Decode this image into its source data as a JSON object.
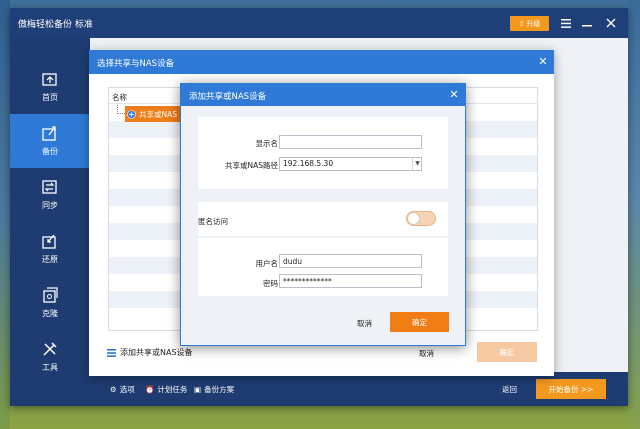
{
  "app": {
    "title": "傲梅轻松备份 标准",
    "upgrade_label": "升级"
  },
  "sidebar": {
    "items": [
      {
        "label": "首页",
        "icon": "home-icon"
      },
      {
        "label": "备份",
        "icon": "backup-icon",
        "active": true
      },
      {
        "label": "同步",
        "icon": "sync-icon"
      },
      {
        "label": "还原",
        "icon": "restore-icon"
      },
      {
        "label": "克隆",
        "icon": "clone-icon"
      },
      {
        "label": "工具",
        "icon": "tools-icon"
      }
    ]
  },
  "bottombar": {
    "options_label": "选项",
    "schedule_label": "计划任务",
    "scheme_label": "备份方案",
    "back_label": "返回",
    "start_label": "开始备份 >>"
  },
  "select_dialog": {
    "title": "选择共享与NAS设备",
    "column_header": "名称",
    "tree_node": "共享或NAS",
    "add_link": "添加共享或NAS设备",
    "cancel_label": "取消",
    "ok_label": "确定"
  },
  "add_dialog": {
    "title": "添加共享或NAS设备",
    "display_name_label": "显示名",
    "display_name_value": "",
    "path_label": "共享或NAS路径",
    "path_value": "192.168.5.30",
    "anonymous_label": "匿名访问",
    "anonymous_enabled": false,
    "username_label": "用户名",
    "username_value": "dudu",
    "password_label": "密码",
    "password_value": "*************",
    "cancel_label": "取消",
    "ok_label": "确定"
  },
  "colors": {
    "accent_blue": "#2f7ad6",
    "navy": "#1e3c72",
    "orange": "#f07d16"
  }
}
